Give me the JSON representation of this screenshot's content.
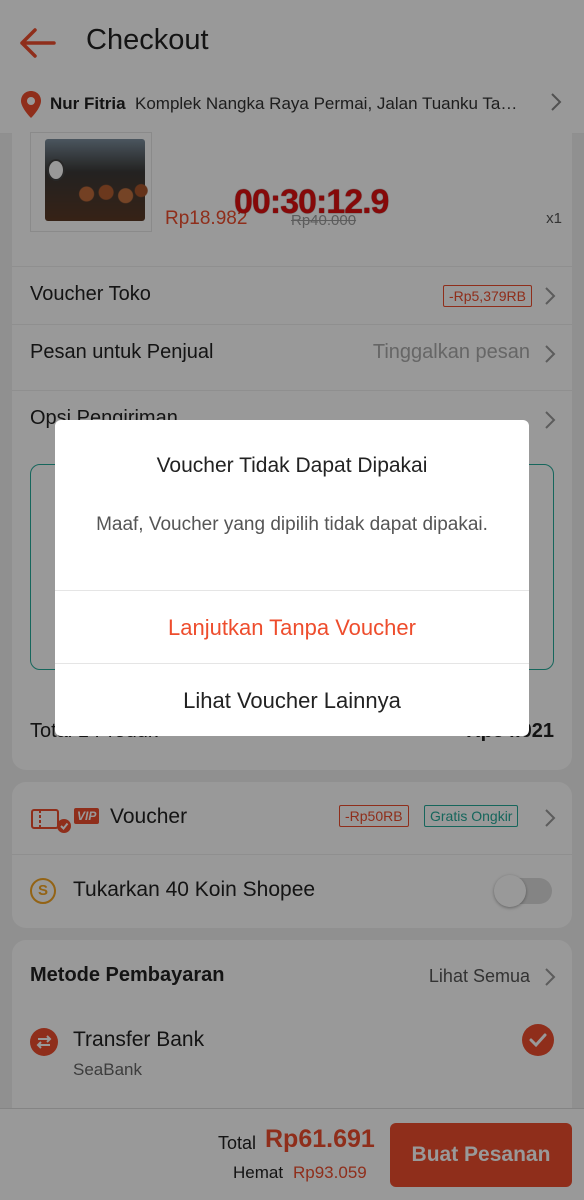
{
  "header": {
    "title": "Checkout"
  },
  "address": {
    "name": "Nur Fitria",
    "text": "Komplek Nangka Raya Permai, Jalan Tuanku Tambusai"
  },
  "product": {
    "price": "Rp18.982",
    "original_price": "Rp40.000",
    "quantity": "x1",
    "timer": "00:30:12.9"
  },
  "rows": {
    "voucher_toko_label": "Voucher Toko",
    "voucher_toko_tag": "-Rp5,379RB",
    "pesan_label": "Pesan untuk Penjual",
    "pesan_placeholder": "Tinggalkan pesan",
    "opsi_label": "Opsi Pengiriman"
  },
  "order_total": {
    "label": "Total 1 Produk",
    "value": "Rp54.021"
  },
  "voucher_section": {
    "vip_badge": "VIP",
    "label": "Voucher",
    "discount_tag": "-Rp50RB",
    "shipping_tag": "Gratis Ongkir",
    "koin_symbol": "S",
    "koin_label": "Tukarkan 40 Koin Shopee"
  },
  "payment": {
    "title": "Metode Pembayaran",
    "see_all": "Lihat Semua",
    "method": "Transfer Bank",
    "bank": "SeaBank"
  },
  "footer": {
    "total_label": "Total",
    "total_value": "Rp61.691",
    "hemat_label": "Hemat",
    "hemat_value": "Rp93.059",
    "buy_label": "Buat Pesanan"
  },
  "dialog": {
    "title": "Voucher Tidak Dapat Dipakai",
    "message": "Maaf, Voucher yang dipilih tidak dapat dipakai.",
    "primary_button": "Lanjutkan Tanpa Voucher",
    "secondary_button": "Lihat Voucher Lainnya"
  },
  "colors": {
    "accent": "#ee4d2d",
    "teal": "#26aa99",
    "coin": "#f5a623"
  }
}
